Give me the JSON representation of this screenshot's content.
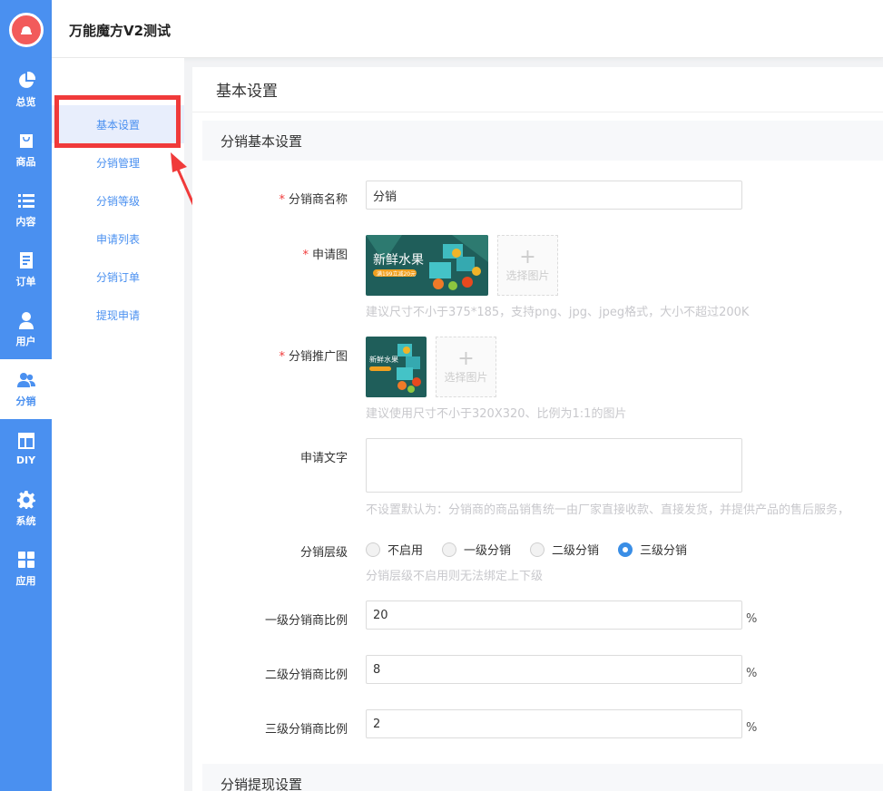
{
  "app": {
    "title": "万能魔方V2测试"
  },
  "nav": {
    "items": [
      {
        "label": "总览",
        "icon": "pie-chart-icon"
      },
      {
        "label": "商品",
        "icon": "shopping-bag-icon"
      },
      {
        "label": "内容",
        "icon": "list-icon"
      },
      {
        "label": "订单",
        "icon": "document-icon"
      },
      {
        "label": "用户",
        "icon": "user-icon"
      },
      {
        "label": "分销",
        "icon": "users-icon"
      },
      {
        "label": "DIY",
        "icon": "layout-icon"
      },
      {
        "label": "系统",
        "icon": "gear-icon"
      },
      {
        "label": "应用",
        "icon": "apps-icon"
      }
    ],
    "active": "分销"
  },
  "submenu": {
    "items": [
      {
        "label": "基本设置"
      },
      {
        "label": "分销管理"
      },
      {
        "label": "分销等级"
      },
      {
        "label": "申请列表"
      },
      {
        "label": "分销订单"
      },
      {
        "label": "提现申请"
      }
    ],
    "active": "基本设置"
  },
  "page": {
    "title": "基本设置",
    "section_basic": "分销基本设置",
    "section_withdraw": "分销提现设置"
  },
  "form": {
    "name": {
      "label": "分销商名称",
      "value": "分销",
      "required": true
    },
    "apply_image": {
      "label": "申请图",
      "required": true,
      "pick_label": "选择图片",
      "hint": "建议尺寸不小于375*185，支持png、jpg、jpeg格式，大小不超过200K",
      "thumb_text": "新鲜水果",
      "thumb_sub": "满199立减20元"
    },
    "promo_image": {
      "label": "分销推广图",
      "required": true,
      "pick_label": "选择图片",
      "hint": "建议使用尺寸不小于320X320、比例为1:1的图片",
      "thumb_text": "新鲜水果"
    },
    "apply_text": {
      "label": "申请文字",
      "value": "",
      "hint": "不设置默认为：分销商的商品销售统一由厂家直接收款、直接发货，并提供产品的售后服务，"
    },
    "level": {
      "label": "分销层级",
      "options": [
        "不启用",
        "一级分销",
        "二级分销",
        "三级分销"
      ],
      "selected": "三级分销",
      "hint": "分销层级不启用则无法绑定上下级"
    },
    "ratio1": {
      "label": "一级分销商比例",
      "value": "20",
      "unit": "%"
    },
    "ratio2": {
      "label": "二级分销商比例",
      "value": "8",
      "unit": "%"
    },
    "ratio3": {
      "label": "三级分销商比例",
      "value": "2",
      "unit": "%"
    }
  },
  "colors": {
    "nav_bg": "#4a90f0",
    "highlight_red": "#f03a3a",
    "radio_on": "#3a8ee6"
  }
}
